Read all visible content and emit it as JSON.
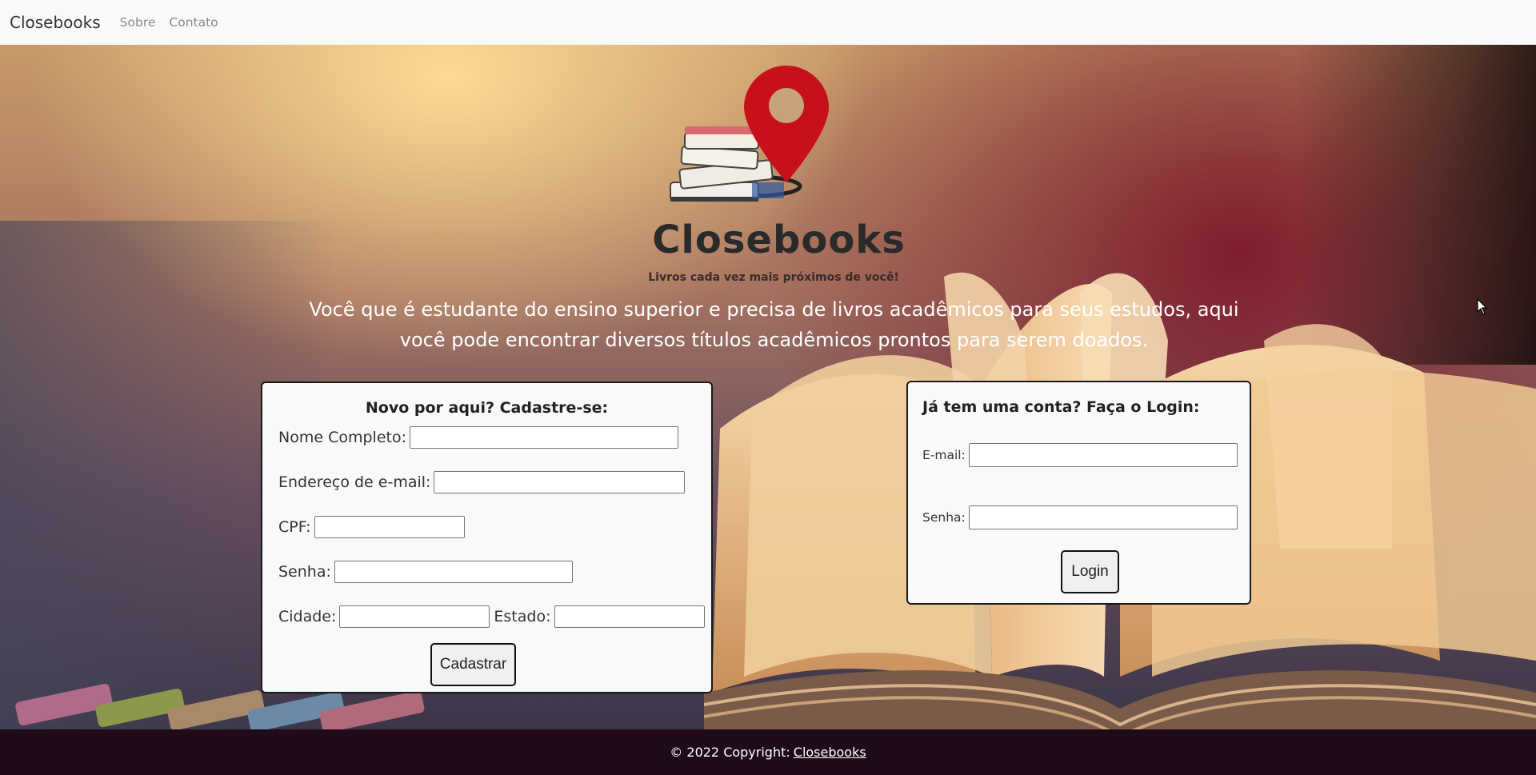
{
  "navbar": {
    "brand": "Closebooks",
    "links": [
      "Sobre",
      "Contato"
    ]
  },
  "hero": {
    "title": "Closebooks",
    "tagline": "Livros cada vez mais próximos de você!",
    "intro": "Você que é estudante do ensino superior e precisa de livros acadêmicos para seus estudos, aqui você pode encontrar diversos títulos acadêmicos prontos para serem doados."
  },
  "register": {
    "title": "Novo por aqui? Cadastre-se:",
    "name_label": "Nome Completo:",
    "name_value": "",
    "email_label": "Endereço de e-mail:",
    "email_value": "",
    "cpf_label": "CPF:",
    "cpf_value": "",
    "password_label": "Senha:",
    "password_value": "",
    "city_label": "Cidade:",
    "city_value": "",
    "state_label": "Estado:",
    "state_value": "",
    "submit_label": "Cadastrar"
  },
  "login": {
    "title": "Já tem uma conta? Faça o Login:",
    "email_label": "E-mail:",
    "email_value": "",
    "password_label": "Senha:",
    "password_value": "",
    "submit_label": "Login"
  },
  "footer": {
    "copyright": "© 2022 Copyright:",
    "link": "Closebooks"
  },
  "colors": {
    "navbar_bg": "#f8f9fa",
    "footer_bg": "#1f0a1a",
    "pin_red": "#c8101a",
    "card_bg": "#f8f9fa"
  },
  "icons": {
    "logo": "books-with-location-pin-logo",
    "cursor": "mouse-pointer-icon"
  }
}
